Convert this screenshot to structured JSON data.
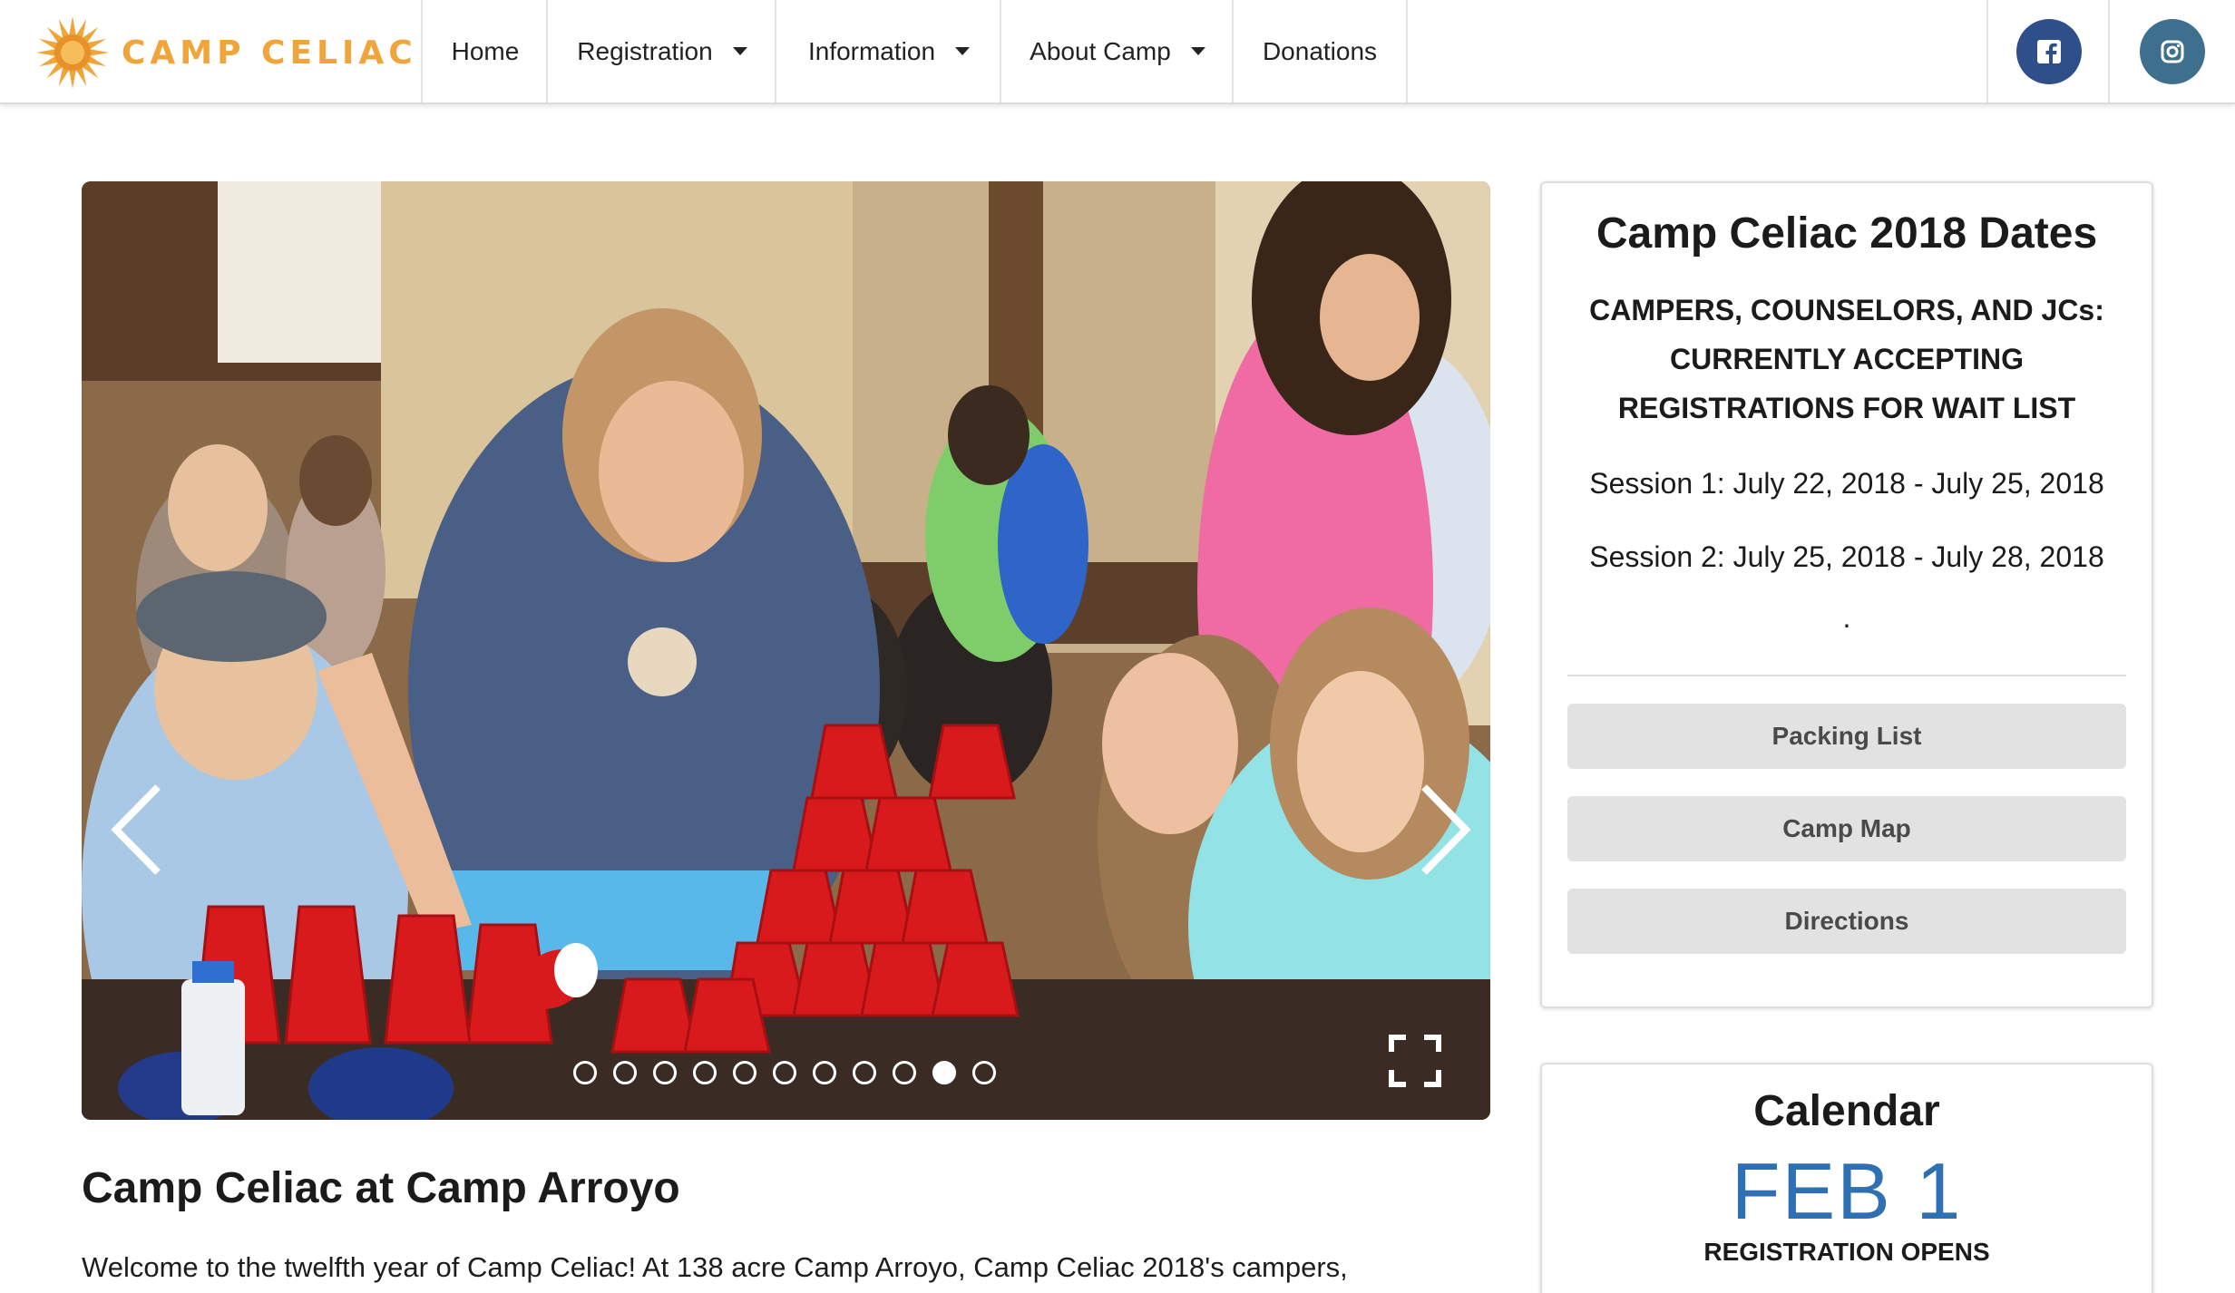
{
  "brand": {
    "name": "CAMP CELIAC",
    "color": "#f0a53a"
  },
  "nav": {
    "items": [
      {
        "label": "Home",
        "dropdown": false
      },
      {
        "label": "Registration",
        "dropdown": true
      },
      {
        "label": "Information",
        "dropdown": true
      },
      {
        "label": "About Camp",
        "dropdown": true
      },
      {
        "label": "Donations",
        "dropdown": false
      }
    ],
    "social": [
      {
        "icon": "facebook-icon",
        "color": "#2f4f8a"
      },
      {
        "icon": "instagram-icon",
        "color": "#3f6f8f"
      }
    ]
  },
  "slider": {
    "slide_count": 11,
    "active_slide": 9,
    "prev_icon": "chevron-left-icon",
    "next_icon": "chevron-right-icon",
    "fullscreen_icon": "fullscreen-icon"
  },
  "article": {
    "title": "Camp Celiac at Camp Arroyo",
    "text": "Welcome to the twelfth year of Camp Celiac! At 138 acre Camp Arroyo, Camp Celiac 2018's campers,"
  },
  "dates_card": {
    "title": "Camp Celiac 2018 Dates",
    "headline_lines": [
      "CAMPERS, COUNSELORS, AND JCs:",
      "CURRENTLY ACCEPTING",
      "REGISTRATIONS FOR WAIT LIST"
    ],
    "session1": "Session 1: July 22, 2018 - July 25, 2018",
    "session2": "Session 2: July 25, 2018 - July 28, 2018",
    "trailing": ".",
    "buttons": [
      "Packing List",
      "Camp Map",
      "Directions"
    ]
  },
  "calendar": {
    "title": "Calendar",
    "date": "FEB 1",
    "event": "REGISTRATION OPENS",
    "accent": "#2f6fb3"
  }
}
